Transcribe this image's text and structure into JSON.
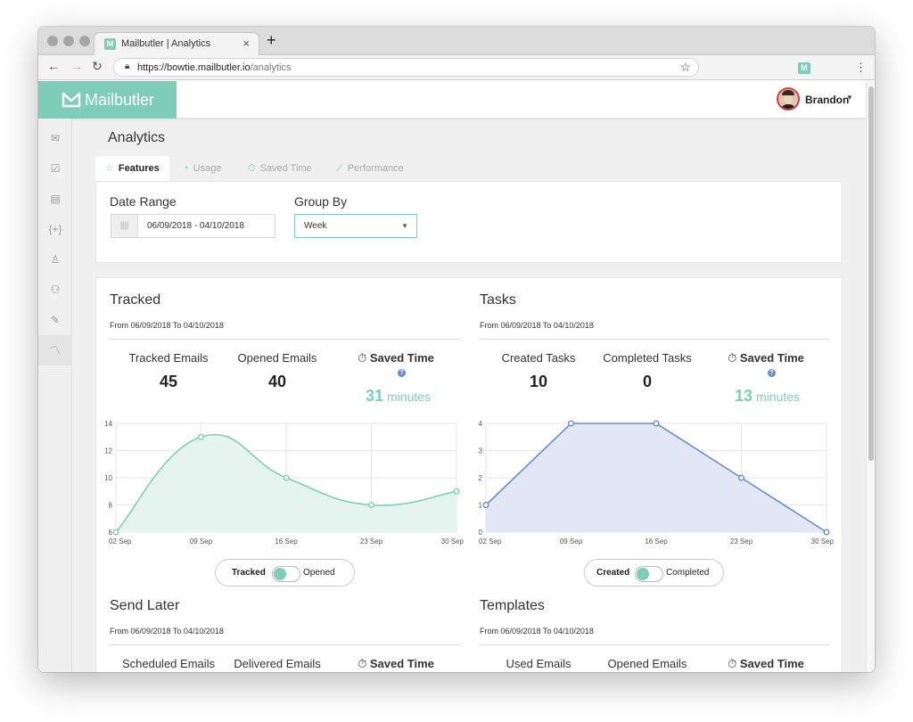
{
  "browser": {
    "tab_title": "Mailbutler | Analytics",
    "favicon_letter": "M",
    "url_host": "https://bowtie.mailbutler.io",
    "url_path": "/analytics"
  },
  "app": {
    "logo_text": "Mailbutler",
    "user_name": "Brandon",
    "brand_color": "#7fcdb6",
    "accent_blue": "#6b8dc8",
    "sidebar_icons": [
      "mail-icon",
      "checkbox-icon",
      "notes-icon",
      "templates-icon",
      "signature-icon",
      "contacts-icon",
      "edit-icon",
      "analytics-icon"
    ]
  },
  "page": {
    "title": "Analytics",
    "tabs": [
      {
        "label": "Features",
        "icon": "star-icon"
      },
      {
        "label": "Usage",
        "icon": "pie-icon"
      },
      {
        "label": "Saved Time",
        "icon": "stopwatch-icon"
      },
      {
        "label": "Performance",
        "icon": "line-chart-icon"
      }
    ],
    "filters": {
      "date_range_label": "Date Range",
      "date_range_value": "06/09/2018 - 04/10/2018",
      "group_by_label": "Group By",
      "group_by_value": "Week"
    }
  },
  "cards": {
    "tracked": {
      "title": "Tracked",
      "subtitle": "From 06/09/2018 To 04/10/2018",
      "stat1_label": "Tracked Emails",
      "stat1_value": "45",
      "stat2_label": "Opened Emails",
      "stat2_value": "40",
      "saved_label": "Saved Time",
      "saved_value": "31",
      "saved_unit": "minutes",
      "toggle_left": "Tracked",
      "toggle_right": "Opened"
    },
    "tasks": {
      "title": "Tasks",
      "subtitle": "From 06/09/2018 To 04/10/2018",
      "stat1_label": "Created Tasks",
      "stat1_value": "10",
      "stat2_label": "Completed Tasks",
      "stat2_value": "0",
      "saved_label": "Saved Time",
      "saved_value": "13",
      "saved_unit": "minutes",
      "toggle_left": "Created",
      "toggle_right": "Completed"
    },
    "send_later": {
      "title": "Send Later",
      "subtitle": "From 06/09/2018 To 04/10/2018",
      "stat1_label": "Scheduled Emails",
      "stat2_label": "Delivered Emails",
      "saved_label": "Saved Time"
    },
    "templates": {
      "title": "Templates",
      "subtitle": "From 06/09/2018 To 04/10/2018",
      "stat1_label": "Used Emails",
      "stat2_label": "Opened Emails",
      "saved_label": "Saved Time"
    }
  },
  "chart_data": [
    {
      "type": "area",
      "categories": [
        "02 Sep",
        "09 Sep",
        "16 Sep",
        "23 Sep",
        "30 Sep"
      ],
      "series": [
        {
          "name": "Tracked",
          "values": [
            6,
            13,
            10,
            8,
            9
          ]
        }
      ],
      "ylim": [
        6,
        14
      ],
      "yticks": [
        6,
        8,
        10,
        12,
        14
      ],
      "grid": true,
      "smooth": true,
      "line_color": "#7fcdb6",
      "fill_color": "#e6f4ef"
    },
    {
      "type": "area",
      "categories": [
        "02 Sep",
        "09 Sep",
        "16 Sep",
        "23 Sep",
        "30 Sep"
      ],
      "series": [
        {
          "name": "Created",
          "values": [
            1,
            4,
            4,
            2,
            0
          ]
        }
      ],
      "ylim": [
        0,
        4
      ],
      "yticks": [
        0,
        1,
        2,
        3,
        4
      ],
      "grid": true,
      "smooth": false,
      "line_color": "#6b8dc8",
      "fill_color": "#e1e7f5"
    }
  ]
}
